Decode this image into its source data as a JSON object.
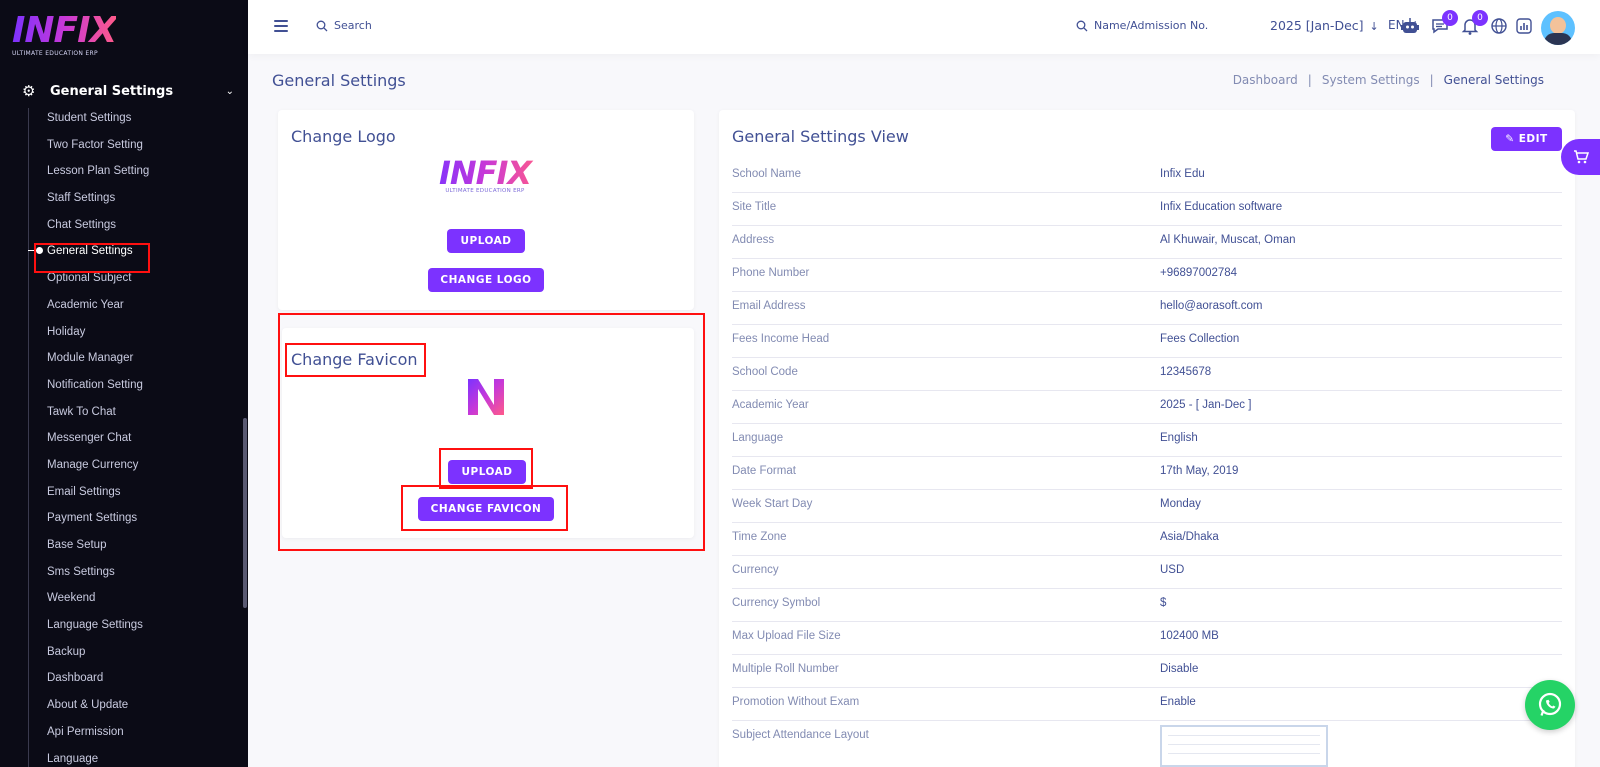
{
  "sidebar": {
    "logo": {
      "text": "INFIX",
      "tagline": "ULTIMATE EDUCATION ERP"
    },
    "group_title": "General Settings",
    "items": [
      {
        "label": "Student Settings"
      },
      {
        "label": "Two Factor Setting"
      },
      {
        "label": "Lesson Plan Setting"
      },
      {
        "label": "Staff Settings"
      },
      {
        "label": "Chat Settings"
      },
      {
        "label": "General Settings",
        "active": true
      },
      {
        "label": "Optional Subject"
      },
      {
        "label": "Academic Year"
      },
      {
        "label": "Holiday"
      },
      {
        "label": "Module Manager"
      },
      {
        "label": "Notification Setting"
      },
      {
        "label": "Tawk To Chat"
      },
      {
        "label": "Messenger Chat"
      },
      {
        "label": "Manage Currency"
      },
      {
        "label": "Email Settings"
      },
      {
        "label": "Payment Settings"
      },
      {
        "label": "Base Setup"
      },
      {
        "label": "Sms Settings"
      },
      {
        "label": "Weekend"
      },
      {
        "label": "Language Settings"
      },
      {
        "label": "Backup"
      },
      {
        "label": "Dashboard"
      },
      {
        "label": "About & Update"
      },
      {
        "label": "Api Permission"
      },
      {
        "label": "Language"
      }
    ]
  },
  "header": {
    "search_placeholder": "Search",
    "name_search_placeholder": "Name/Admission No.",
    "academic_year": "2025 [Jan-Dec]",
    "language": "EN",
    "chat_badge": "0",
    "notification_badge": "0"
  },
  "page": {
    "title": "General Settings",
    "breadcrumb": [
      "Dashboard",
      "System Settings",
      "General Settings"
    ]
  },
  "logo_card": {
    "title": "Change Logo",
    "logo_text": "INFIX",
    "logo_tagline": "ULTIMATE EDUCATION ERP",
    "upload_label": "UPLOAD",
    "change_label": "CHANGE LOGO"
  },
  "favicon_card": {
    "title": "Change Favicon",
    "upload_label": "UPLOAD",
    "change_label": "CHANGE FAVICON"
  },
  "details": {
    "title": "General Settings View",
    "edit_label": "EDIT",
    "rows": [
      {
        "key": "School Name",
        "value": "Infix Edu"
      },
      {
        "key": "Site Title",
        "value": "Infix Education software"
      },
      {
        "key": "Address",
        "value": "Al Khuwair, Muscat, Oman"
      },
      {
        "key": "Phone Number",
        "value": "+96897002784"
      },
      {
        "key": "Email Address",
        "value": "hello@aorasoft.com"
      },
      {
        "key": "Fees Income Head",
        "value": "Fees Collection"
      },
      {
        "key": "School Code",
        "value": "12345678"
      },
      {
        "key": "Academic Year",
        "value": "2025 - [ Jan-Dec ]"
      },
      {
        "key": "Language",
        "value": "English"
      },
      {
        "key": "Date Format",
        "value": "17th May, 2019"
      },
      {
        "key": "Week Start Day",
        "value": "Monday"
      },
      {
        "key": "Time Zone",
        "value": "Asia/Dhaka"
      },
      {
        "key": "Currency",
        "value": "USD"
      },
      {
        "key": "Currency Symbol",
        "value": "$"
      },
      {
        "key": "Max Upload File Size",
        "value": "102400 MB"
      },
      {
        "key": "Multiple Roll Number",
        "value": "Disable"
      },
      {
        "key": "Promotion Without Exam",
        "value": "Enable"
      },
      {
        "key": "Subject Attendance Layout",
        "value": ""
      }
    ]
  },
  "colors": {
    "accent": "#7c32ff",
    "sidebar_bg": "#0b0b16",
    "text": "#415094",
    "highlight": "#ff1010",
    "whatsapp": "#25d366"
  }
}
